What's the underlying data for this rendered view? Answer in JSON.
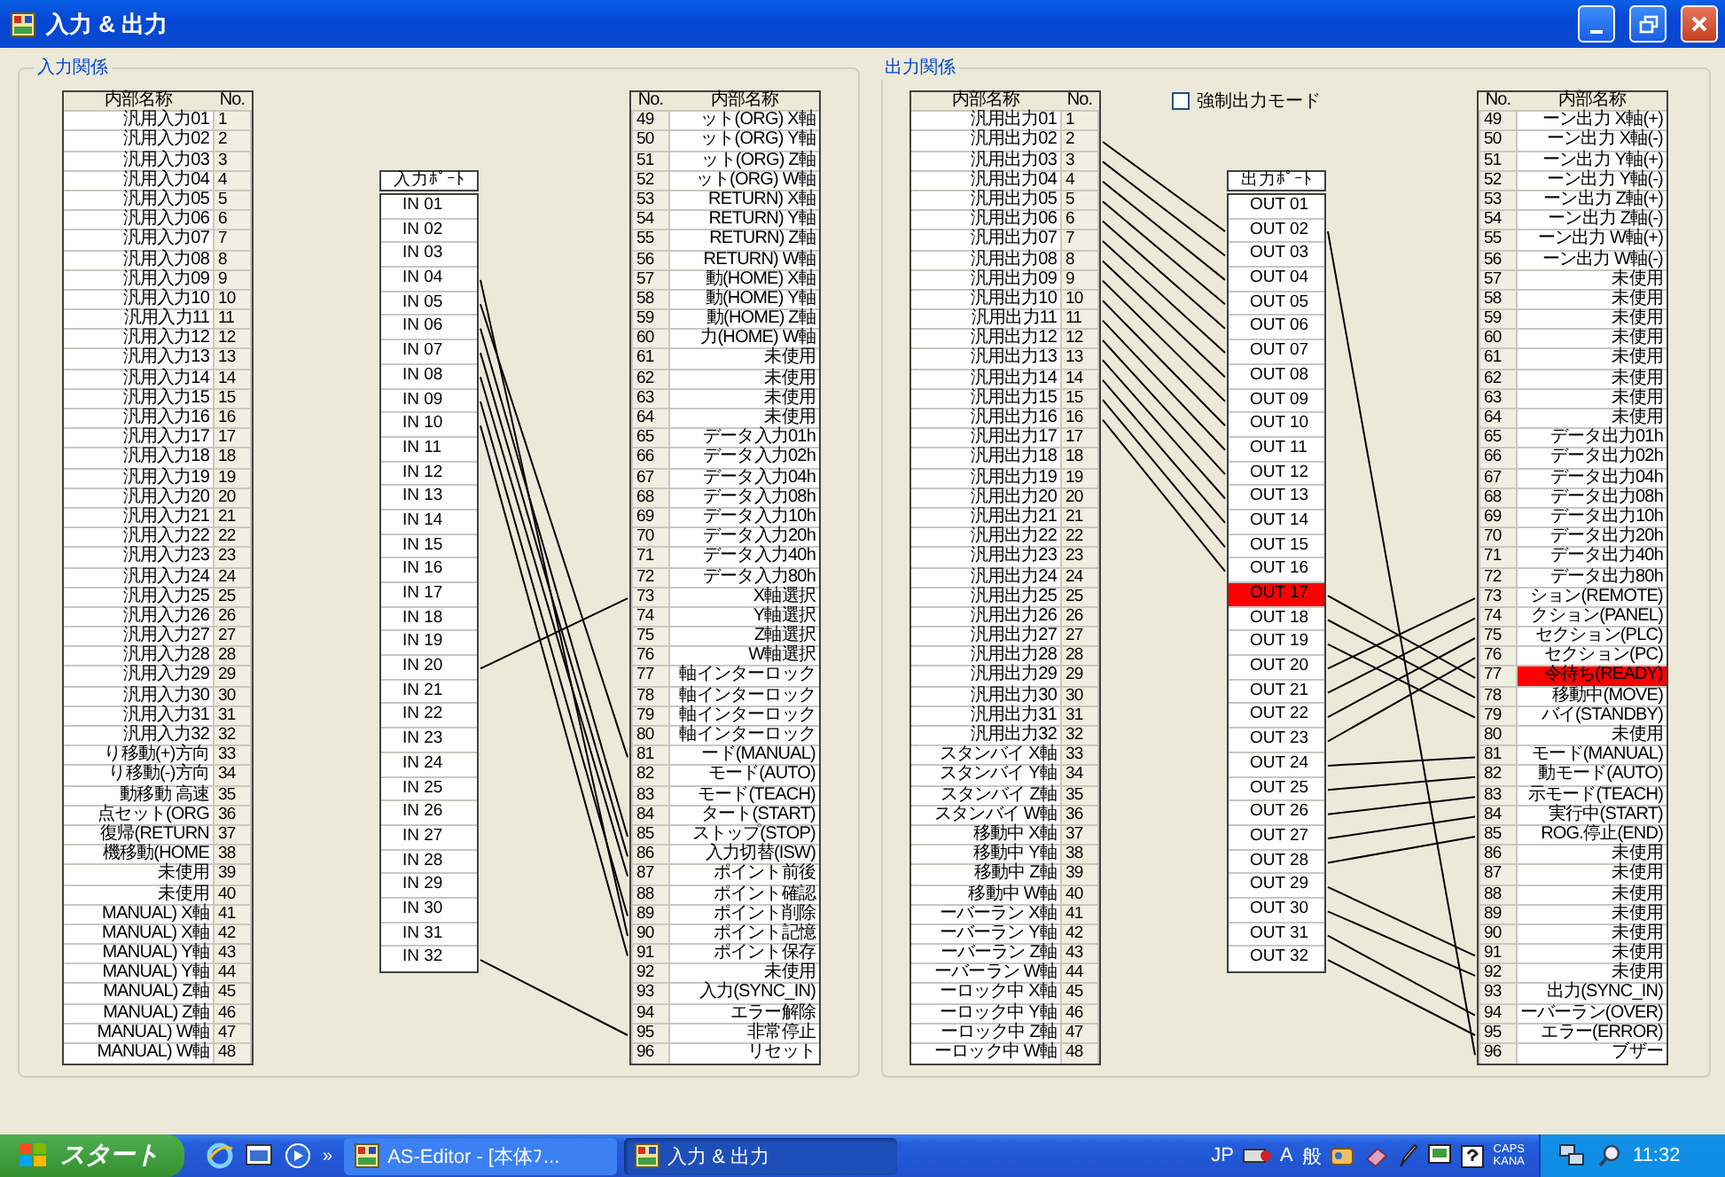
{
  "window": {
    "title": "入力 & 出力"
  },
  "input_group": {
    "title": "入力関係",
    "left_table": {
      "columns": [
        "内部名称",
        "No."
      ],
      "rows": [
        {
          "name": "汎用入力01",
          "no": "1",
          "selected": false
        },
        {
          "name": "汎用入力02",
          "no": "2",
          "selected": false
        },
        {
          "name": "汎用入力03",
          "no": "3",
          "selected": false
        },
        {
          "name": "汎用入力04",
          "no": "4",
          "selected": false
        },
        {
          "name": "汎用入力05",
          "no": "5",
          "selected": false
        },
        {
          "name": "汎用入力06",
          "no": "6",
          "selected": false
        },
        {
          "name": "汎用入力07",
          "no": "7",
          "selected": false
        },
        {
          "name": "汎用入力08",
          "no": "8",
          "selected": false
        },
        {
          "name": "汎用入力09",
          "no": "9",
          "selected": false
        },
        {
          "name": "汎用入力10",
          "no": "10",
          "selected": false
        },
        {
          "name": "汎用入力11",
          "no": "11",
          "selected": false
        },
        {
          "name": "汎用入力12",
          "no": "12",
          "selected": false
        },
        {
          "name": "汎用入力13",
          "no": "13",
          "selected": false
        },
        {
          "name": "汎用入力14",
          "no": "14",
          "selected": false
        },
        {
          "name": "汎用入力15",
          "no": "15",
          "selected": false
        },
        {
          "name": "汎用入力16",
          "no": "16",
          "selected": false
        },
        {
          "name": "汎用入力17",
          "no": "17",
          "selected": false
        },
        {
          "name": "汎用入力18",
          "no": "18",
          "selected": false
        },
        {
          "name": "汎用入力19",
          "no": "19",
          "selected": false
        },
        {
          "name": "汎用入力20",
          "no": "20",
          "selected": false
        },
        {
          "name": "汎用入力21",
          "no": "21",
          "selected": false
        },
        {
          "name": "汎用入力22",
          "no": "22",
          "selected": false
        },
        {
          "name": "汎用入力23",
          "no": "23",
          "selected": false
        },
        {
          "name": "汎用入力24",
          "no": "24",
          "selected": false
        },
        {
          "name": "汎用入力25",
          "no": "25",
          "selected": false
        },
        {
          "name": "汎用入力26",
          "no": "26",
          "selected": false
        },
        {
          "name": "汎用入力27",
          "no": "27",
          "selected": false
        },
        {
          "name": "汎用入力28",
          "no": "28",
          "selected": false
        },
        {
          "name": "汎用入力29",
          "no": "29",
          "selected": false
        },
        {
          "name": "汎用入力30",
          "no": "30",
          "selected": false
        },
        {
          "name": "汎用入力31",
          "no": "31",
          "selected": false
        },
        {
          "name": "汎用入力32",
          "no": "32",
          "selected": false
        },
        {
          "name": "り移動(+)方向",
          "no": "33",
          "selected": false
        },
        {
          "name": "り移動(-)方向",
          "no": "34",
          "selected": false
        },
        {
          "name": "動移動 高速",
          "no": "35",
          "selected": false
        },
        {
          "name": "点セット(ORG",
          "no": "36",
          "selected": false
        },
        {
          "name": "復帰(RETURN",
          "no": "37",
          "selected": false
        },
        {
          "name": "機移動(HOME",
          "no": "38",
          "selected": false
        },
        {
          "name": "未使用",
          "no": "39",
          "selected": false
        },
        {
          "name": "未使用",
          "no": "40",
          "selected": false
        },
        {
          "name": "MANUAL) X軸",
          "no": "41",
          "selected": false
        },
        {
          "name": "MANUAL) X軸",
          "no": "42",
          "selected": false
        },
        {
          "name": "MANUAL) Y軸",
          "no": "43",
          "selected": false
        },
        {
          "name": "MANUAL) Y軸",
          "no": "44",
          "selected": false
        },
        {
          "name": "MANUAL) Z軸",
          "no": "45",
          "selected": false
        },
        {
          "name": "MANUAL) Z軸",
          "no": "46",
          "selected": false
        },
        {
          "name": "MANUAL) W軸",
          "no": "47",
          "selected": false
        },
        {
          "name": "MANUAL) W軸",
          "no": "48",
          "selected": false
        }
      ]
    },
    "port_list": {
      "header": "入力ﾎﾟｰﾄ",
      "ports": [
        {
          "label": "IN 01",
          "selected": false
        },
        {
          "label": "IN 02",
          "selected": false
        },
        {
          "label": "IN 03",
          "selected": false
        },
        {
          "label": "IN 04",
          "selected": false
        },
        {
          "label": "IN 05",
          "selected": false
        },
        {
          "label": "IN 06",
          "selected": false
        },
        {
          "label": "IN 07",
          "selected": false
        },
        {
          "label": "IN 08",
          "selected": false
        },
        {
          "label": "IN 09",
          "selected": false
        },
        {
          "label": "IN 10",
          "selected": false
        },
        {
          "label": "IN 11",
          "selected": false
        },
        {
          "label": "IN 12",
          "selected": false
        },
        {
          "label": "IN 13",
          "selected": false
        },
        {
          "label": "IN 14",
          "selected": false
        },
        {
          "label": "IN 15",
          "selected": false
        },
        {
          "label": "IN 16",
          "selected": false
        },
        {
          "label": "IN 17",
          "selected": false
        },
        {
          "label": "IN 18",
          "selected": false
        },
        {
          "label": "IN 19",
          "selected": false
        },
        {
          "label": "IN 20",
          "selected": false
        },
        {
          "label": "IN 21",
          "selected": false
        },
        {
          "label": "IN 22",
          "selected": false
        },
        {
          "label": "IN 23",
          "selected": false
        },
        {
          "label": "IN 24",
          "selected": false
        },
        {
          "label": "IN 25",
          "selected": false
        },
        {
          "label": "IN 26",
          "selected": false
        },
        {
          "label": "IN 27",
          "selected": false
        },
        {
          "label": "IN 28",
          "selected": false
        },
        {
          "label": "IN 29",
          "selected": false
        },
        {
          "label": "IN 30",
          "selected": false
        },
        {
          "label": "IN 31",
          "selected": false
        },
        {
          "label": "IN 32",
          "selected": false
        }
      ]
    },
    "right_table": {
      "columns": [
        "No.",
        "内部名称"
      ],
      "rows": [
        {
          "name": "ット(ORG) X軸",
          "no": "49",
          "selected": false
        },
        {
          "name": "ット(ORG) Y軸",
          "no": "50",
          "selected": false
        },
        {
          "name": "ット(ORG) Z軸",
          "no": "51",
          "selected": false
        },
        {
          "name": "ット(ORG) W軸",
          "no": "52",
          "selected": false
        },
        {
          "name": "RETURN) X軸",
          "no": "53",
          "selected": false
        },
        {
          "name": "RETURN) Y軸",
          "no": "54",
          "selected": false
        },
        {
          "name": "RETURN) Z軸",
          "no": "55",
          "selected": false
        },
        {
          "name": "RETURN) W軸",
          "no": "56",
          "selected": false
        },
        {
          "name": "動(HOME) X軸",
          "no": "57",
          "selected": false
        },
        {
          "name": "動(HOME) Y軸",
          "no": "58",
          "selected": false
        },
        {
          "name": "動(HOME) Z軸",
          "no": "59",
          "selected": false
        },
        {
          "name": "力(HOME) W軸",
          "no": "60",
          "selected": false
        },
        {
          "name": "未使用",
          "no": "61",
          "selected": false
        },
        {
          "name": "未使用",
          "no": "62",
          "selected": false
        },
        {
          "name": "未使用",
          "no": "63",
          "selected": false
        },
        {
          "name": "未使用",
          "no": "64",
          "selected": false
        },
        {
          "name": "データ入力01h",
          "no": "65",
          "selected": false
        },
        {
          "name": "データ入力02h",
          "no": "66",
          "selected": false
        },
        {
          "name": "データ入力04h",
          "no": "67",
          "selected": false
        },
        {
          "name": "データ入力08h",
          "no": "68",
          "selected": false
        },
        {
          "name": "データ入力10h",
          "no": "69",
          "selected": false
        },
        {
          "name": "データ入力20h",
          "no": "70",
          "selected": false
        },
        {
          "name": "データ入力40h",
          "no": "71",
          "selected": false
        },
        {
          "name": "データ入力80h",
          "no": "72",
          "selected": false
        },
        {
          "name": "X軸選択",
          "no": "73",
          "selected": false
        },
        {
          "name": "Y軸選択",
          "no": "74",
          "selected": false
        },
        {
          "name": "Z軸選択",
          "no": "75",
          "selected": false
        },
        {
          "name": "W軸選択",
          "no": "76",
          "selected": false
        },
        {
          "name": "軸インターロック",
          "no": "77",
          "selected": false
        },
        {
          "name": "軸インターロック",
          "no": "78",
          "selected": false
        },
        {
          "name": "軸インターロック",
          "no": "79",
          "selected": false
        },
        {
          "name": "軸インターロック",
          "no": "80",
          "selected": false
        },
        {
          "name": "ード(MANUAL)",
          "no": "81",
          "selected": false
        },
        {
          "name": "モード(AUTO)",
          "no": "82",
          "selected": false
        },
        {
          "name": "モード(TEACH)",
          "no": "83",
          "selected": false
        },
        {
          "name": "タート(START)",
          "no": "84",
          "selected": false
        },
        {
          "name": "ストップ(STOP)",
          "no": "85",
          "selected": false
        },
        {
          "name": "入力切替(ISW)",
          "no": "86",
          "selected": false
        },
        {
          "name": "ポイント前後",
          "no": "87",
          "selected": false
        },
        {
          "name": "ポイント確認",
          "no": "88",
          "selected": false
        },
        {
          "name": "ポイント削除",
          "no": "89",
          "selected": false
        },
        {
          "name": "ポイント記憶",
          "no": "90",
          "selected": false
        },
        {
          "name": "ポイント保存",
          "no": "91",
          "selected": false
        },
        {
          "name": "未使用",
          "no": "92",
          "selected": false
        },
        {
          "name": "入力(SYNC_IN)",
          "no": "93",
          "selected": false
        },
        {
          "name": "エラー解除",
          "no": "94",
          "selected": false
        },
        {
          "name": "非常停止",
          "no": "95",
          "selected": false
        },
        {
          "name": "リセット",
          "no": "96",
          "selected": false
        }
      ]
    }
  },
  "output_group": {
    "title": "出力関係",
    "force_output": {
      "label": "強制出力モード",
      "checked": false
    },
    "left_table": {
      "columns": [
        "内部名称",
        "No."
      ],
      "rows": [
        {
          "name": "汎用出力01",
          "no": "1",
          "selected": false
        },
        {
          "name": "汎用出力02",
          "no": "2",
          "selected": false
        },
        {
          "name": "汎用出力03",
          "no": "3",
          "selected": false
        },
        {
          "name": "汎用出力04",
          "no": "4",
          "selected": false
        },
        {
          "name": "汎用出力05",
          "no": "5",
          "selected": false
        },
        {
          "name": "汎用出力06",
          "no": "6",
          "selected": false
        },
        {
          "name": "汎用出力07",
          "no": "7",
          "selected": false
        },
        {
          "name": "汎用出力08",
          "no": "8",
          "selected": false
        },
        {
          "name": "汎用出力09",
          "no": "9",
          "selected": false
        },
        {
          "name": "汎用出力10",
          "no": "10",
          "selected": false
        },
        {
          "name": "汎用出力11",
          "no": "11",
          "selected": false
        },
        {
          "name": "汎用出力12",
          "no": "12",
          "selected": false
        },
        {
          "name": "汎用出力13",
          "no": "13",
          "selected": false
        },
        {
          "name": "汎用出力14",
          "no": "14",
          "selected": false
        },
        {
          "name": "汎用出力15",
          "no": "15",
          "selected": false
        },
        {
          "name": "汎用出力16",
          "no": "16",
          "selected": false
        },
        {
          "name": "汎用出力17",
          "no": "17",
          "selected": false
        },
        {
          "name": "汎用出力18",
          "no": "18",
          "selected": false
        },
        {
          "name": "汎用出力19",
          "no": "19",
          "selected": false
        },
        {
          "name": "汎用出力20",
          "no": "20",
          "selected": false
        },
        {
          "name": "汎用出力21",
          "no": "21",
          "selected": false
        },
        {
          "name": "汎用出力22",
          "no": "22",
          "selected": false
        },
        {
          "name": "汎用出力23",
          "no": "23",
          "selected": false
        },
        {
          "name": "汎用出力24",
          "no": "24",
          "selected": false
        },
        {
          "name": "汎用出力25",
          "no": "25",
          "selected": false
        },
        {
          "name": "汎用出力26",
          "no": "26",
          "selected": false
        },
        {
          "name": "汎用出力27",
          "no": "27",
          "selected": false
        },
        {
          "name": "汎用出力28",
          "no": "28",
          "selected": false
        },
        {
          "name": "汎用出力29",
          "no": "29",
          "selected": false
        },
        {
          "name": "汎用出力30",
          "no": "30",
          "selected": false
        },
        {
          "name": "汎用出力31",
          "no": "31",
          "selected": false
        },
        {
          "name": "汎用出力32",
          "no": "32",
          "selected": false
        },
        {
          "name": "スタンバイ X軸",
          "no": "33",
          "selected": false
        },
        {
          "name": "スタンバイ Y軸",
          "no": "34",
          "selected": false
        },
        {
          "name": "スタンバイ Z軸",
          "no": "35",
          "selected": false
        },
        {
          "name": "スタンバイ W軸",
          "no": "36",
          "selected": false
        },
        {
          "name": "移動中 X軸",
          "no": "37",
          "selected": false
        },
        {
          "name": "移動中 Y軸",
          "no": "38",
          "selected": false
        },
        {
          "name": "移動中 Z軸",
          "no": "39",
          "selected": false
        },
        {
          "name": "移動中 W軸",
          "no": "40",
          "selected": false
        },
        {
          "name": "ーバーラン X軸",
          "no": "41",
          "selected": false
        },
        {
          "name": "ーバーラン Y軸",
          "no": "42",
          "selected": false
        },
        {
          "name": "ーバーラン Z軸",
          "no": "43",
          "selected": false
        },
        {
          "name": "ーバーラン W軸",
          "no": "44",
          "selected": false
        },
        {
          "name": "ーロック中 X軸",
          "no": "45",
          "selected": false
        },
        {
          "name": "ーロック中 Y軸",
          "no": "46",
          "selected": false
        },
        {
          "name": "ーロック中 Z軸",
          "no": "47",
          "selected": false
        },
        {
          "name": "ーロック中 W軸",
          "no": "48",
          "selected": false
        }
      ]
    },
    "port_list": {
      "header": "出力ﾎﾟｰﾄ",
      "ports": [
        {
          "label": "OUT 01",
          "selected": false
        },
        {
          "label": "OUT 02",
          "selected": false
        },
        {
          "label": "OUT 03",
          "selected": false
        },
        {
          "label": "OUT 04",
          "selected": false
        },
        {
          "label": "OUT 05",
          "selected": false
        },
        {
          "label": "OUT 06",
          "selected": false
        },
        {
          "label": "OUT 07",
          "selected": false
        },
        {
          "label": "OUT 08",
          "selected": false
        },
        {
          "label": "OUT 09",
          "selected": false
        },
        {
          "label": "OUT 10",
          "selected": false
        },
        {
          "label": "OUT 11",
          "selected": false
        },
        {
          "label": "OUT 12",
          "selected": false
        },
        {
          "label": "OUT 13",
          "selected": false
        },
        {
          "label": "OUT 14",
          "selected": false
        },
        {
          "label": "OUT 15",
          "selected": false
        },
        {
          "label": "OUT 16",
          "selected": false
        },
        {
          "label": "OUT 17",
          "selected": true
        },
        {
          "label": "OUT 18",
          "selected": false
        },
        {
          "label": "OUT 19",
          "selected": false
        },
        {
          "label": "OUT 20",
          "selected": false
        },
        {
          "label": "OUT 21",
          "selected": false
        },
        {
          "label": "OUT 22",
          "selected": false
        },
        {
          "label": "OUT 23",
          "selected": false
        },
        {
          "label": "OUT 24",
          "selected": false
        },
        {
          "label": "OUT 25",
          "selected": false
        },
        {
          "label": "OUT 26",
          "selected": false
        },
        {
          "label": "OUT 27",
          "selected": false
        },
        {
          "label": "OUT 28",
          "selected": false
        },
        {
          "label": "OUT 29",
          "selected": false
        },
        {
          "label": "OUT 30",
          "selected": false
        },
        {
          "label": "OUT 31",
          "selected": false
        },
        {
          "label": "OUT 32",
          "selected": false
        }
      ]
    },
    "right_table": {
      "columns": [
        "No.",
        "内部名称"
      ],
      "rows": [
        {
          "name": "ーン出力 X軸(+)",
          "no": "49",
          "selected": false
        },
        {
          "name": "ーン出力 X軸(-)",
          "no": "50",
          "selected": false
        },
        {
          "name": "ーン出力 Y軸(+)",
          "no": "51",
          "selected": false
        },
        {
          "name": "ーン出力 Y軸(-)",
          "no": "52",
          "selected": false
        },
        {
          "name": "ーン出力 Z軸(+)",
          "no": "53",
          "selected": false
        },
        {
          "name": "ーン出力 Z軸(-)",
          "no": "54",
          "selected": false
        },
        {
          "name": "ーン出力 W軸(+)",
          "no": "55",
          "selected": false
        },
        {
          "name": "ーン出力 W軸(-)",
          "no": "56",
          "selected": false
        },
        {
          "name": "未使用",
          "no": "57",
          "selected": false
        },
        {
          "name": "未使用",
          "no": "58",
          "selected": false
        },
        {
          "name": "未使用",
          "no": "59",
          "selected": false
        },
        {
          "name": "未使用",
          "no": "60",
          "selected": false
        },
        {
          "name": "未使用",
          "no": "61",
          "selected": false
        },
        {
          "name": "未使用",
          "no": "62",
          "selected": false
        },
        {
          "name": "未使用",
          "no": "63",
          "selected": false
        },
        {
          "name": "未使用",
          "no": "64",
          "selected": false
        },
        {
          "name": "データ出力01h",
          "no": "65",
          "selected": false
        },
        {
          "name": "データ出力02h",
          "no": "66",
          "selected": false
        },
        {
          "name": "データ出力04h",
          "no": "67",
          "selected": false
        },
        {
          "name": "データ出力08h",
          "no": "68",
          "selected": false
        },
        {
          "name": "データ出力10h",
          "no": "69",
          "selected": false
        },
        {
          "name": "データ出力20h",
          "no": "70",
          "selected": false
        },
        {
          "name": "データ出力40h",
          "no": "71",
          "selected": false
        },
        {
          "name": "データ出力80h",
          "no": "72",
          "selected": false
        },
        {
          "name": "ション(REMOTE)",
          "no": "73",
          "selected": false
        },
        {
          "name": "クション(PANEL)",
          "no": "74",
          "selected": false
        },
        {
          "name": "セクション(PLC)",
          "no": "75",
          "selected": false
        },
        {
          "name": "セクション(PC)",
          "no": "76",
          "selected": false
        },
        {
          "name": "令待ち(READY)",
          "no": "77",
          "selected": true
        },
        {
          "name": "移動中(MOVE)",
          "no": "78",
          "selected": false
        },
        {
          "name": "バイ(STANDBY)",
          "no": "79",
          "selected": false
        },
        {
          "name": "未使用",
          "no": "80",
          "selected": false
        },
        {
          "name": "モード(MANUAL)",
          "no": "81",
          "selected": false
        },
        {
          "name": "動モード(AUTO)",
          "no": "82",
          "selected": false
        },
        {
          "name": "示モード(TEACH)",
          "no": "83",
          "selected": false
        },
        {
          "name": "実行中(START)",
          "no": "84",
          "selected": false
        },
        {
          "name": "ROG.停止(END)",
          "no": "85",
          "selected": false
        },
        {
          "name": "未使用",
          "no": "86",
          "selected": false
        },
        {
          "name": "未使用",
          "no": "87",
          "selected": false
        },
        {
          "name": "未使用",
          "no": "88",
          "selected": false
        },
        {
          "name": "未使用",
          "no": "89",
          "selected": false
        },
        {
          "name": "未使用",
          "no": "90",
          "selected": false
        },
        {
          "name": "未使用",
          "no": "91",
          "selected": false
        },
        {
          "name": "未使用",
          "no": "92",
          "selected": false
        },
        {
          "name": "出力(SYNC_IN)",
          "no": "93",
          "selected": false
        },
        {
          "name": "ーバーラン(OVER)",
          "no": "94",
          "selected": false
        },
        {
          "name": "エラー(ERROR)",
          "no": "95",
          "selected": false
        },
        {
          "name": "ブザー",
          "no": "96",
          "selected": false
        }
      ]
    }
  },
  "taskbar": {
    "start": "スタート",
    "chevron": "»",
    "tasks": [
      {
        "label": "AS-Editor - [本体ﾌ...",
        "selected": false
      },
      {
        "label": "入力 & 出力",
        "selected": true
      }
    ],
    "language": "JP",
    "ime_mode": "A",
    "ime_input": "般",
    "caps": "CAPS",
    "kana": "KANA",
    "clock": "11:32"
  }
}
